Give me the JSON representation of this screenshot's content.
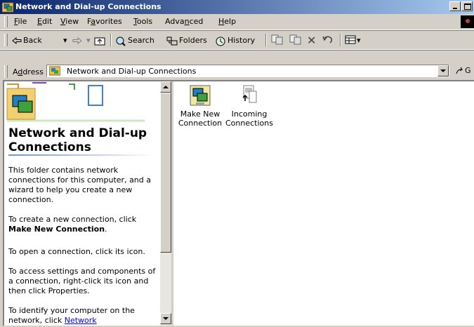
{
  "window": {
    "title": "Network and Dial-up Connections"
  },
  "menu": [
    {
      "key": "F",
      "rest": "ile"
    },
    {
      "key": "E",
      "rest": "dit"
    },
    {
      "key": "V",
      "rest": "iew"
    },
    {
      "pre": "F",
      "key": "a",
      "rest": "vorites"
    },
    {
      "key": "T",
      "rest": "ools"
    },
    {
      "pre": "Adva",
      "key": "n",
      "rest": "ced"
    },
    {
      "key": "H",
      "rest": "elp"
    }
  ],
  "toolbar": {
    "back_label": "Back",
    "search_label": "Search",
    "folders_label": "Folders",
    "history_label": "History"
  },
  "address": {
    "label_key": "d",
    "label_pre": "A",
    "label_rest": "dress",
    "value": "Network and Dial-up Connections",
    "go_label": "G"
  },
  "left_pane": {
    "title": "Network and Dial-up Connections",
    "p1": "This folder contains network connections for this computer, and a wizard to help you create a new connection.",
    "p2_pre": "To create a new connection, click",
    "p2_bold": "Make New Connection",
    "p2_post": ".",
    "p3": "To open a connection, click its icon.",
    "p4": "To access settings and components of a connection, right-click its icon and then click Properties.",
    "p5_pre": "To identify your computer on the network, click",
    "p5_link": "Network"
  },
  "items": [
    {
      "label_line1": "Make New",
      "label_line2": "Connection",
      "icon": "make-new-connection-icon"
    },
    {
      "label_line1": "Incoming",
      "label_line2": "Connections",
      "icon": "incoming-connections-icon"
    }
  ],
  "colors": {
    "title_start": "#0a246a",
    "title_end": "#a6caf0",
    "link": "#0000ff"
  }
}
